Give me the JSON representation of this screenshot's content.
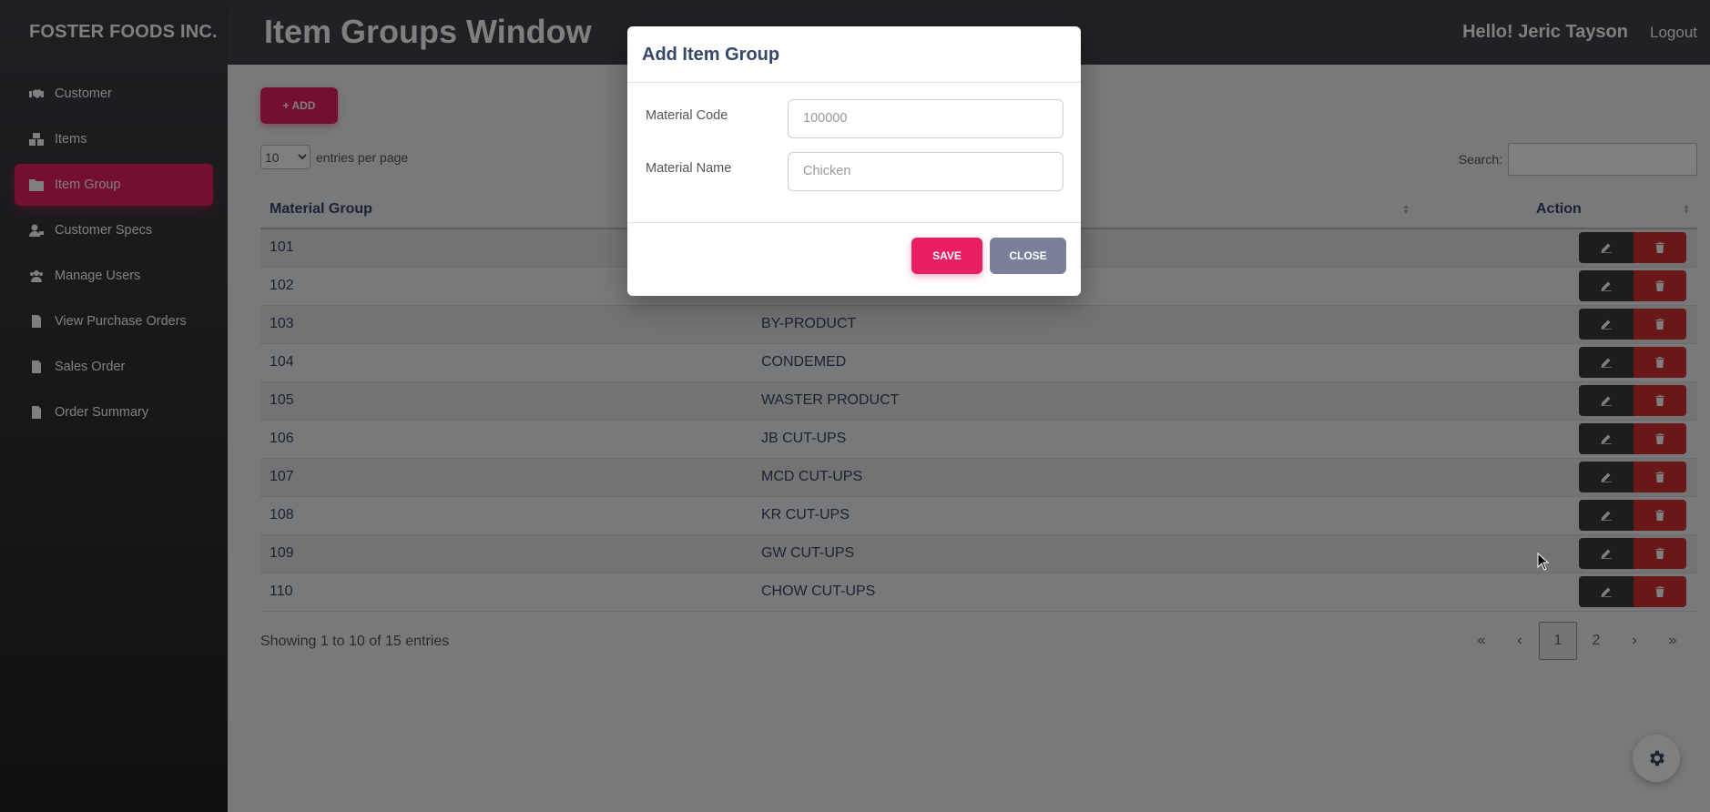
{
  "brand": "FOSTER FOODS INC.",
  "sidebar": {
    "items": [
      {
        "label": "Customer",
        "icon": "handshake-icon"
      },
      {
        "label": "Items",
        "icon": "boxes-icon"
      },
      {
        "label": "Item Group",
        "icon": "folder-icon",
        "active": true
      },
      {
        "label": "Customer Specs",
        "icon": "user-tag-icon"
      },
      {
        "label": "Manage Users",
        "icon": "users-icon"
      },
      {
        "label": "View Purchase Orders",
        "icon": "file-icon"
      },
      {
        "label": "Sales Order",
        "icon": "file-icon"
      },
      {
        "label": "Order Summary",
        "icon": "file-icon"
      }
    ]
  },
  "header": {
    "title": "Item Groups Window",
    "greeting": "Hello! Jeric Tayson",
    "logout": "Logout"
  },
  "toolbar": {
    "add_label": "+ ADD",
    "entries_value": "10",
    "entries_suffix": "entries per page",
    "search_label": "Search:"
  },
  "table": {
    "headers": [
      "Material Group",
      "",
      "Action"
    ],
    "rows": [
      {
        "code": "101",
        "name": ""
      },
      {
        "code": "102",
        "name": ""
      },
      {
        "code": "103",
        "name": "BY-PRODUCT"
      },
      {
        "code": "104",
        "name": "CONDEMED"
      },
      {
        "code": "105",
        "name": "WASTER PRODUCT"
      },
      {
        "code": "106",
        "name": "JB CUT-UPS"
      },
      {
        "code": "107",
        "name": "MCD CUT-UPS"
      },
      {
        "code": "108",
        "name": "KR CUT-UPS"
      },
      {
        "code": "109",
        "name": "GW CUT-UPS"
      },
      {
        "code": "110",
        "name": "CHOW CUT-UPS"
      }
    ]
  },
  "footer": {
    "showing": "Showing 1 to 10 of 15 entries",
    "pager": {
      "first": "«",
      "prev": "‹",
      "pages": [
        "1",
        "2"
      ],
      "next": "›",
      "last": "»"
    }
  },
  "modal": {
    "title": "Add Item Group",
    "fields": [
      {
        "label": "Material Code",
        "placeholder": "100000"
      },
      {
        "label": "Material Name",
        "placeholder": "Chicken"
      }
    ],
    "save_label": "SAVE",
    "close_label": "CLOSE"
  },
  "colors": {
    "accent": "#e91e63",
    "danger": "#d32f2f",
    "header": "#42424a",
    "secondary": "#7b809a"
  }
}
